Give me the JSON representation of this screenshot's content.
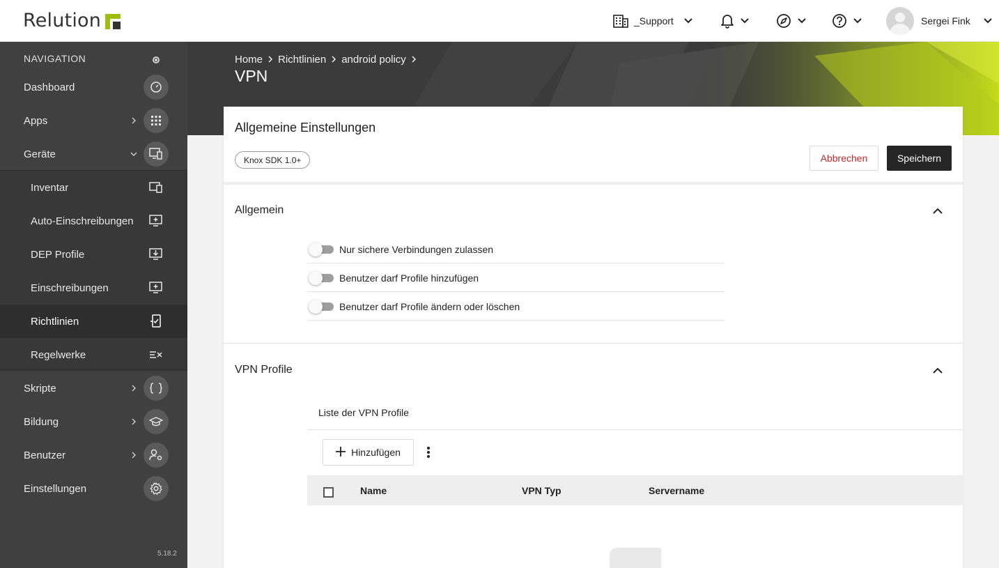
{
  "app": {
    "logo_text": "Relution"
  },
  "topbar": {
    "organization": "_Support",
    "user_name": "Sergei Fink"
  },
  "sidebar": {
    "header": "NAVIGATION",
    "version": "5.18.2",
    "items": [
      {
        "label": "Dashboard",
        "icon": "speedometer-icon"
      },
      {
        "label": "Apps",
        "icon": "grid-icon"
      },
      {
        "label": "Geräte",
        "icon": "devices-icon"
      },
      {
        "label": "Inventar",
        "icon": "inventory-icon"
      },
      {
        "label": "Auto-Einschreibungen",
        "icon": "auto-enroll-icon"
      },
      {
        "label": "DEP Profile",
        "icon": "dep-profile-icon"
      },
      {
        "label": "Einschreibungen",
        "icon": "enrollment-icon"
      },
      {
        "label": "Richtlinien",
        "icon": "policy-icon"
      },
      {
        "label": "Regelwerke",
        "icon": "ruleset-icon"
      },
      {
        "label": "Skripte",
        "icon": "braces-icon"
      },
      {
        "label": "Bildung",
        "icon": "graduation-cap-icon"
      },
      {
        "label": "Benutzer",
        "icon": "user-settings-icon"
      },
      {
        "label": "Einstellungen",
        "icon": "gear-icon"
      }
    ]
  },
  "breadcrumb": {
    "items": [
      "Home",
      "Richtlinien",
      "android policy"
    ],
    "sep": "›"
  },
  "page_title": "VPN",
  "card": {
    "title": "Allgemeine Einstellungen",
    "chip": "Knox SDK 1.0+",
    "cancel_label": "Abbrechen",
    "save_label": "Speichern"
  },
  "general": {
    "title": "Allgemein",
    "toggles": [
      {
        "label": "Nur sichere Verbindungen zulassen",
        "on": false
      },
      {
        "label": "Benutzer darf Profile hinzufügen",
        "on": false
      },
      {
        "label": "Benutzer darf Profile ändern oder löschen",
        "on": false
      }
    ]
  },
  "vpn_profiles": {
    "title": "VPN Profile",
    "list_title": "Liste der VPN Profile",
    "add_label": "Hinzufügen",
    "columns": [
      "Name",
      "VPN Typ",
      "Servername"
    ]
  },
  "colors": {
    "accent": "#9cbf0f",
    "sidebar_bg": "#404040",
    "danger": "#c62828",
    "primary_button": "#262626"
  }
}
